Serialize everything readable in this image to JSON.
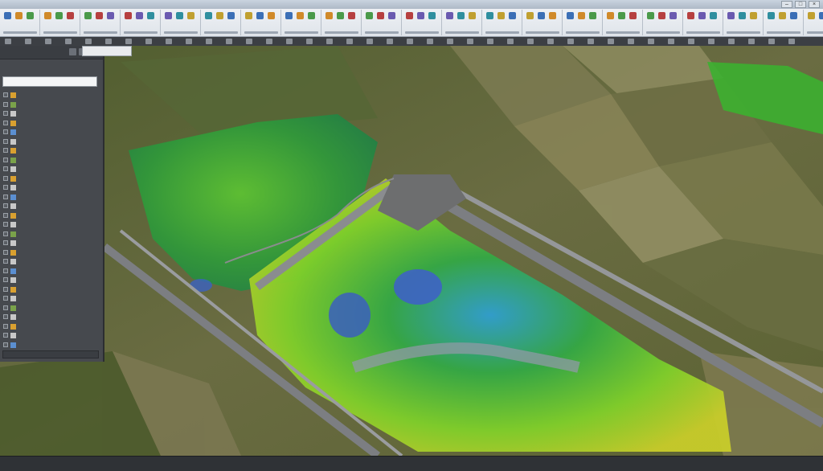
{
  "window": {
    "title": "",
    "controls": [
      "–",
      "□",
      "×"
    ]
  },
  "ribbon": {
    "group_count": 21,
    "icon_colors": [
      "#3b6fb6",
      "#d08a2a",
      "#4a9a4a",
      "#b64040",
      "#6a5ab0",
      "#2f8f9f",
      "#c0a030"
    ]
  },
  "layers_panel": {
    "title": "",
    "search_placeholder": "",
    "layers": [
      {
        "name": "",
        "color": "#d9a030"
      },
      {
        "name": "",
        "color": "#7aa24a"
      },
      {
        "name": "",
        "color": "#c8c8c8"
      },
      {
        "name": "",
        "color": "#d9a030"
      },
      {
        "name": "",
        "color": "#5b8fd1"
      },
      {
        "name": "",
        "color": "#c8c8c8"
      },
      {
        "name": "",
        "color": "#d9a030"
      },
      {
        "name": "",
        "color": "#7aa24a"
      },
      {
        "name": "",
        "color": "#c8c8c8"
      },
      {
        "name": "",
        "color": "#d9a030"
      },
      {
        "name": "",
        "color": "#c8c8c8"
      },
      {
        "name": "",
        "color": "#5b8fd1"
      },
      {
        "name": "",
        "color": "#c8c8c8"
      },
      {
        "name": "",
        "color": "#d9a030"
      },
      {
        "name": "",
        "color": "#c8c8c8"
      },
      {
        "name": "",
        "color": "#7aa24a"
      },
      {
        "name": "",
        "color": "#c8c8c8"
      },
      {
        "name": "",
        "color": "#d9a030"
      },
      {
        "name": "",
        "color": "#c8c8c8"
      },
      {
        "name": "",
        "color": "#5b8fd1"
      },
      {
        "name": "",
        "color": "#c8c8c8"
      },
      {
        "name": "",
        "color": "#d9a030"
      },
      {
        "name": "",
        "color": "#c8c8c8"
      },
      {
        "name": "",
        "color": "#7aa24a"
      },
      {
        "name": "",
        "color": "#c8c8c8"
      },
      {
        "name": "",
        "color": "#d9a030"
      },
      {
        "name": "",
        "color": "#c8c8c8"
      },
      {
        "name": "",
        "color": "#5b8fd1"
      }
    ]
  },
  "map": {
    "basemap": "aerial-imagery",
    "overlay": "vegetation-index-raster",
    "colors": {
      "farmland_dark": "#4e5a2c",
      "farmland_light": "#8c8a5e",
      "overlay_green": "#3fae2e",
      "overlay_lime": "#9ad12a",
      "overlay_yellow": "#d7c62a",
      "overlay_blue": "#3f6fc6",
      "road": "#7b7d80"
    }
  },
  "status_bar": {
    "items": [
      "",
      "",
      "",
      "",
      ""
    ]
  }
}
